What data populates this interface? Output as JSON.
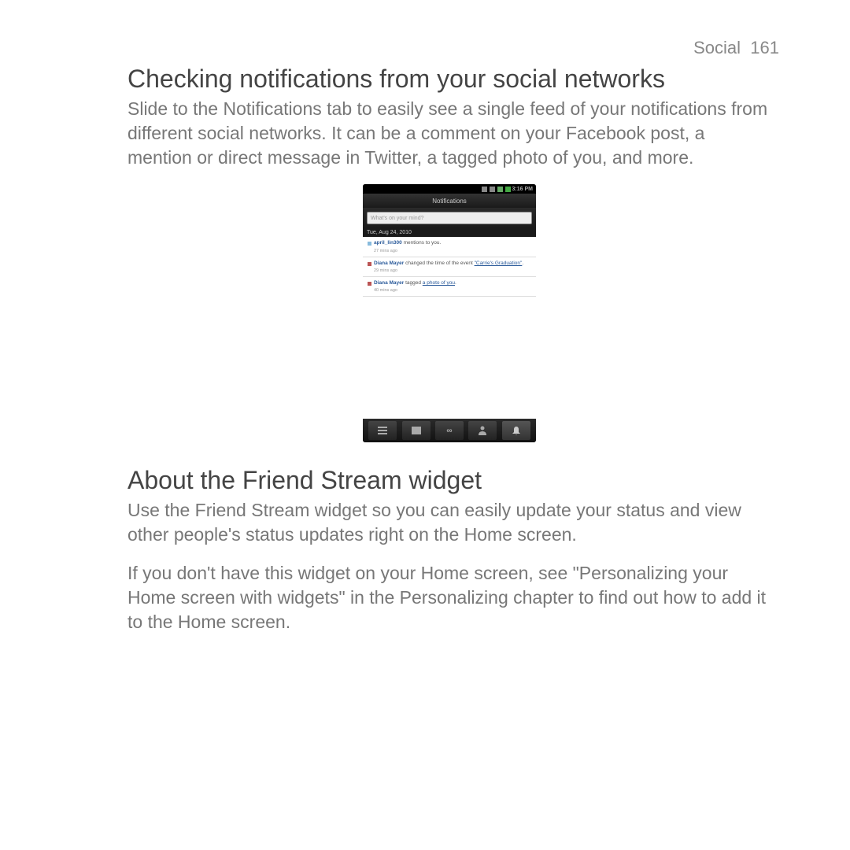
{
  "header": {
    "section": "Social",
    "page": "161"
  },
  "main": {
    "heading1": "Checking notifications from your social networks",
    "para1": "Slide to the Notifications tab to easily see a single feed of your notifications from different social networks. It can be a comment on your Facebook post, a mention or direct message in Twitter, a tagged photo of you, and more.",
    "heading2": "About the Friend Stream widget",
    "para2": "Use the Friend Stream widget so you can easily update your status and view other people's status updates right on the Home screen.",
    "para3": "If you don't have this widget on your Home screen, see \"Personalizing your Home screen with widgets\" in the Personalizing chapter to find out how to add it to the Home screen."
  },
  "phone": {
    "time": "3:16 PM",
    "title": "Notifications",
    "status_placeholder": "What's on your mind?",
    "date": "Tue, Aug 24, 2010",
    "feed": [
      {
        "name": "april_lin300",
        "text": " mentions to you.",
        "time": "27 mins ago",
        "link": ""
      },
      {
        "name": "Diana Mayer",
        "text": " changed the time of the event ",
        "link": "\"Carrie's Graduation\"",
        "tail": ".",
        "time": "29 mins ago"
      },
      {
        "name": "Diana Mayer",
        "text": " tagged ",
        "link": "a photo of you",
        "tail": ".",
        "time": "40 mins ago"
      }
    ],
    "nav_link_label": "∞"
  }
}
